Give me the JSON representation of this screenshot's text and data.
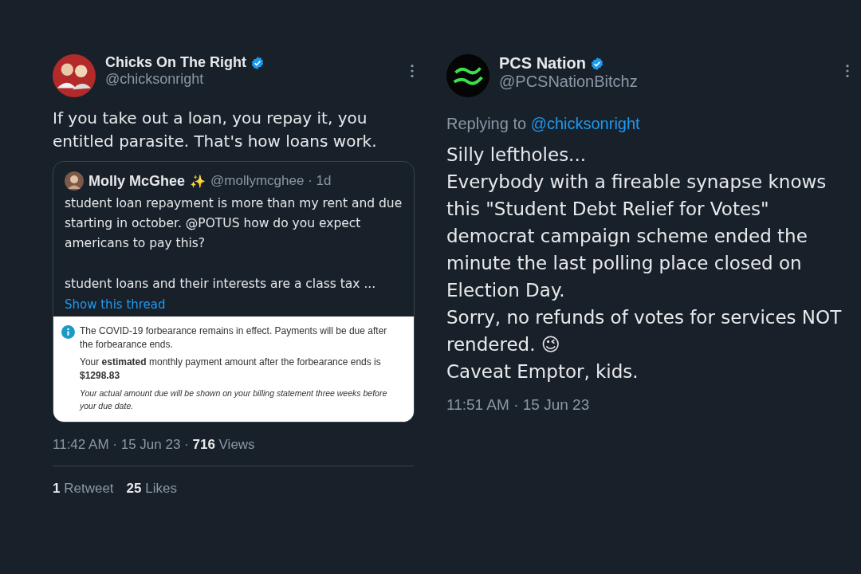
{
  "tweets": [
    {
      "name": "Chicks On The Right",
      "verified": true,
      "handle": "@chicksonright",
      "text": [
        "If you take out a loan, you repay it, you entitled parasite.  That's how loans work."
      ],
      "quote": {
        "name": "Molly McGhee",
        "name_emoji": "✨",
        "handle": "@mollymcghee · 1d",
        "text": [
          "student loan repayment is more than my rent and due starting in october. @POTUS how do you expect americans to pay this?",
          "student loans and their interests are a class tax ..."
        ],
        "link": "Show this thread",
        "notice": {
          "lines": [
            "The COVID-19 forbearance remains in effect. Payments will be due after the forbearance ends.",
            "Your **estimated** monthly payment amount after the forbearance ends is **$1298.83**"
          ],
          "note": "Your actual amount due will be shown on your billing statement three weeks before your due date."
        }
      },
      "meta": "11:42 AM · 15 Jun 23 · **716** Views",
      "stats": [
        "**1** Retweet",
        "**25** Likes"
      ]
    },
    {
      "name": "PCS Nation",
      "verified": true,
      "handle": "@PCSNationBitchz",
      "reply_label": "Replying to",
      "reply_to": "@chicksonright",
      "text": [
        "Silly leftholes...",
        "Everybody with a fireable synapse knows this \"Student Debt Relief for Votes\" democrat campaign scheme ended the minute the last polling place closed on Election Day.",
        "Sorry, no refunds of votes for services NOT rendered. 😉",
        "Caveat Emptor, kids."
      ],
      "meta": "11:51 AM · 15 Jun 23"
    }
  ]
}
